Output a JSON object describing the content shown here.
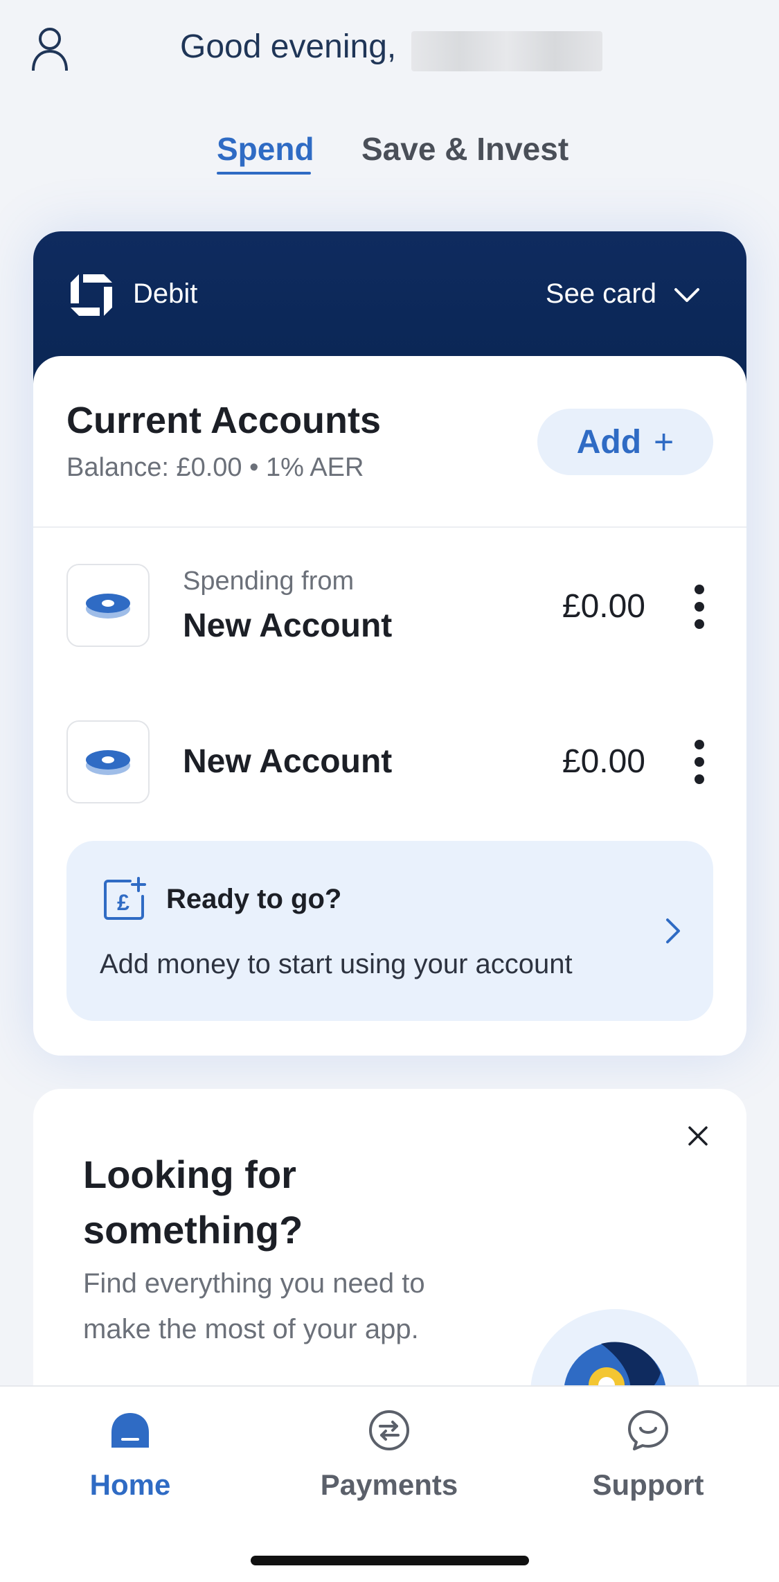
{
  "header": {
    "greeting": "Good evening,"
  },
  "tabs": [
    {
      "label": "Spend",
      "active": true
    },
    {
      "label": "Save & Invest",
      "active": false
    }
  ],
  "card": {
    "type_label": "Debit",
    "see_card_label": "See card"
  },
  "current_accounts": {
    "title": "Current Accounts",
    "balance_line": "Balance: £0.00 • 1% AER",
    "add_label": "Add",
    "add_icon": "plus-icon",
    "accounts": [
      {
        "sublabel": "Spending from",
        "name": "New Account",
        "amount": "£0.00"
      },
      {
        "sublabel": "",
        "name": "New Account",
        "amount": "£0.00"
      }
    ],
    "ready": {
      "title": "Ready to go?",
      "text": "Add money to start using your account"
    }
  },
  "looking": {
    "title": "Looking for something?",
    "text": "Find everything you need to make the most of your app."
  },
  "bottom_nav": [
    {
      "label": "Home",
      "icon": "home-icon",
      "active": true
    },
    {
      "label": "Payments",
      "icon": "payments-icon",
      "active": false
    },
    {
      "label": "Support",
      "icon": "support-icon",
      "active": false
    }
  ],
  "colors": {
    "accent": "#2f6bc4",
    "navy": "#0f2b5f",
    "background": "#f2f4f8",
    "light_blue": "#e9f1fc"
  }
}
